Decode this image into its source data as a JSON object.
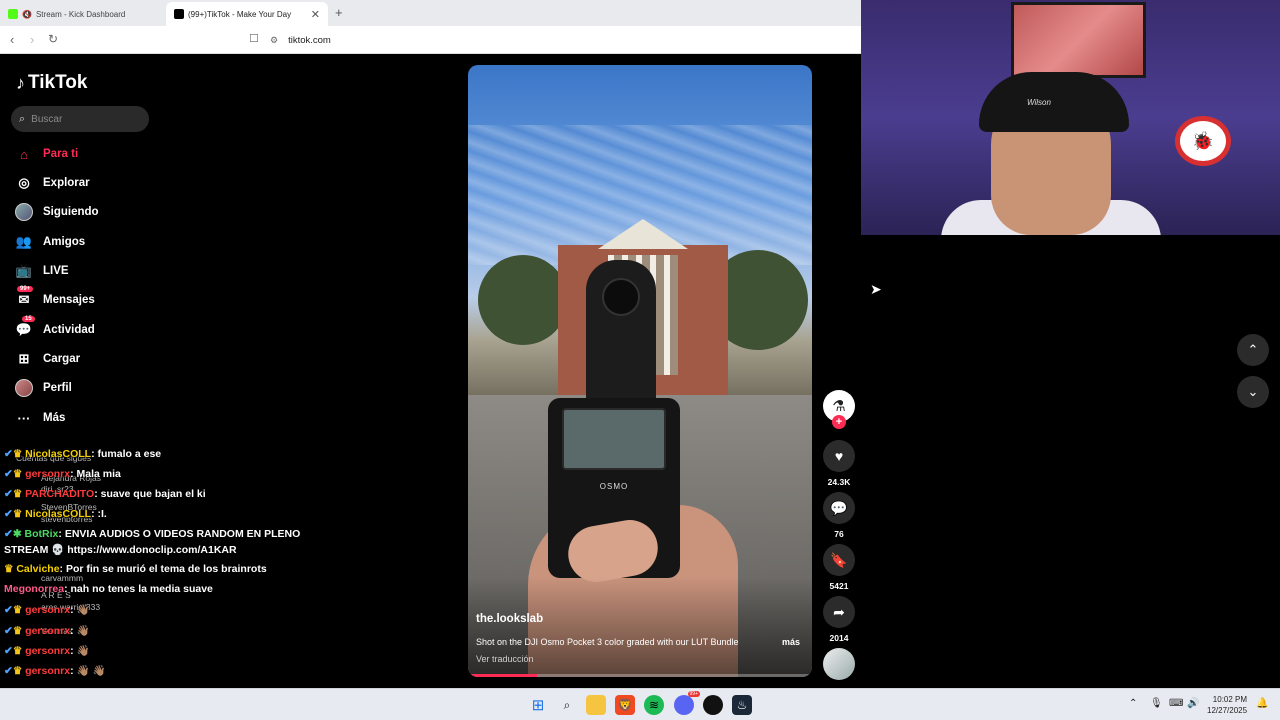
{
  "browser": {
    "tabs": [
      {
        "title": "Stream - Kick Dashboard",
        "active": false
      },
      {
        "title": "(99+)TikTok - Make Your Day",
        "active": true
      }
    ],
    "url": "tiktok.com"
  },
  "tiktok": {
    "logo": "TikTok",
    "search_placeholder": "Buscar",
    "nav": [
      {
        "label": "Para ti",
        "icon": "home-icon",
        "active": true
      },
      {
        "label": "Explorar",
        "icon": "compass-icon"
      },
      {
        "label": "Siguiendo",
        "icon": "following-avatar-icon"
      },
      {
        "label": "Amigos",
        "icon": "friends-icon"
      },
      {
        "label": "LIVE",
        "icon": "live-tv-icon"
      },
      {
        "label": "Mensajes",
        "icon": "messages-icon",
        "badge": "99+"
      },
      {
        "label": "Actividad",
        "icon": "activity-icon",
        "badge": "15"
      },
      {
        "label": "Cargar",
        "icon": "upload-icon"
      },
      {
        "label": "Perfil",
        "icon": "profile-avatar-icon"
      },
      {
        "label": "Más",
        "icon": "more-icon"
      }
    ],
    "video": {
      "username": "the.lookslab",
      "description": "Shot on the DJI Osmo Pocket 3 color graded with our LUT Bundle",
      "more": "más",
      "translate": "Ver traducción",
      "device_label": "OSMO",
      "progress": 0.2
    },
    "actions": {
      "likes": "24.3K",
      "comments": "76",
      "saves": "5421",
      "shares": "2014"
    }
  },
  "chat": [
    {
      "user": "NicolasCOLL",
      "msg": "fumalo a ese",
      "color": "#f5d000"
    },
    {
      "user": "gersonrx",
      "msg": "Mala mia",
      "color": "#ff3b3b"
    },
    {
      "user": "PARCHADITO",
      "msg": "suave que bajan el ki",
      "color": "#ff3b3b"
    },
    {
      "user": "NicolasCOLL",
      "msg": ":I.",
      "color": "#f5d000"
    },
    {
      "user": "BotRix",
      "msg": "ENVIA AUDIOS O VIDEOS RANDOM EN PLENO",
      "color": "#4cd964"
    },
    {
      "user": "",
      "msg": "STREAM 💀 https://www.donoclip.com/A1KAR",
      "color": "#fff"
    },
    {
      "user": "Calviche",
      "msg": "Por fin se murió el tema de los brainrots",
      "color": "#f5d000"
    },
    {
      "user": "Megonorrea",
      "msg": "nah no tenes la media suave",
      "color": "#ff5a8a"
    },
    {
      "user": "gersonrx",
      "msg": "👋🏽",
      "color": "#ff3b3b"
    },
    {
      "user": "gersonrx",
      "msg": "👋🏽",
      "color": "#ff3b3b"
    },
    {
      "user": "gersonrx",
      "msg": "👋🏽",
      "color": "#ff3b3b"
    },
    {
      "user": "gersonrx",
      "msg": "👋🏽 👋🏽",
      "color": "#ff3b3b"
    }
  ],
  "ghost_text": {
    "following_header": "Cuentas que sigues",
    "accounts": [
      "Alejandra Rojas",
      "diri_sr23",
      "StevenBTorres",
      "stevenbtorres",
      "carvammm",
      "A R E S",
      "ares.warrior333"
    ],
    "see_more": "Ver más"
  },
  "webcam": {
    "cap_brand": "Wilson"
  },
  "taskbar": {
    "time": "10:02 PM",
    "date": "12/27/2025",
    "discord_badge": "99+"
  }
}
